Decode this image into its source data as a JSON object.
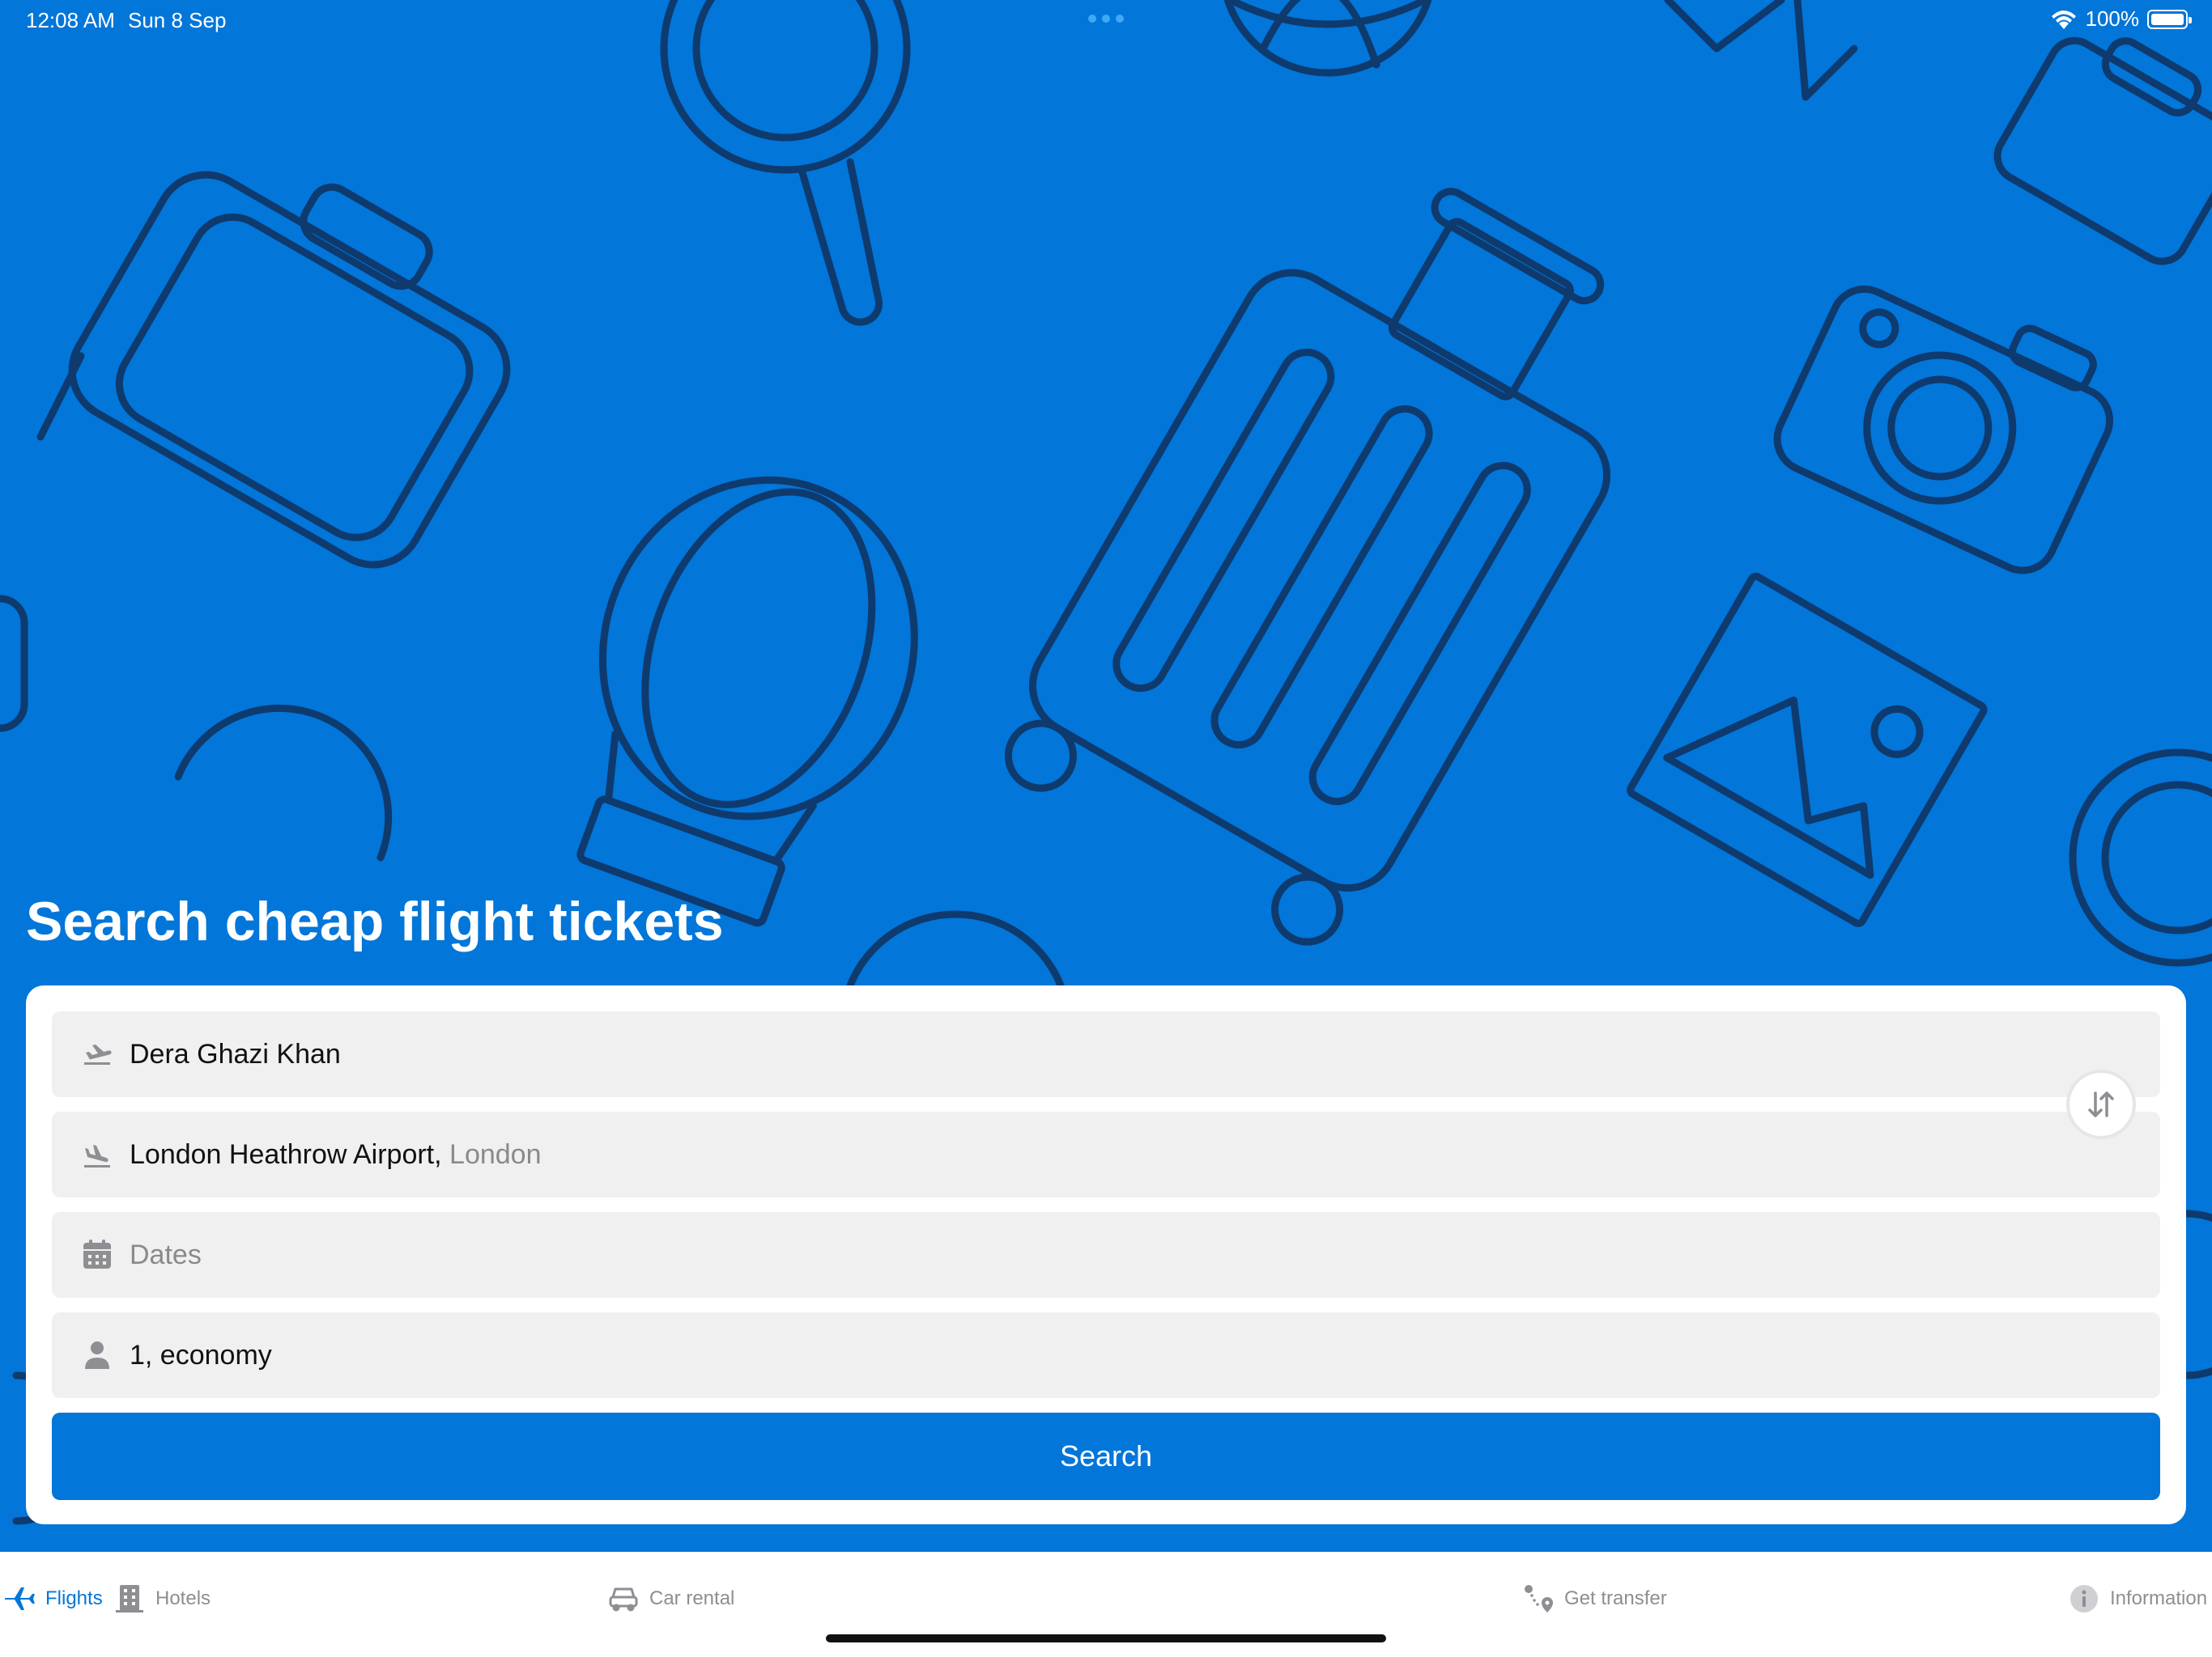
{
  "status_bar": {
    "time": "12:08 AM",
    "date": "Sun 8 Sep",
    "battery": "100%"
  },
  "headline": "Search cheap flight tickets",
  "form": {
    "origin": {
      "value": "Dera Ghazi Khan"
    },
    "destination": {
      "value": "London Heathrow Airport,",
      "hint": "London"
    },
    "dates": {
      "placeholder": "Dates"
    },
    "passengers": {
      "value": "1, economy"
    },
    "search_label": "Search"
  },
  "tabs": [
    {
      "label": "Flights",
      "icon": "airplane-icon",
      "active": true
    },
    {
      "label": "Hotels",
      "icon": "building-icon",
      "active": false
    },
    {
      "label": "Car rental",
      "icon": "car-icon",
      "active": false
    },
    {
      "label": "Get transfer",
      "icon": "route-pin-icon",
      "active": false
    },
    {
      "label": "Information",
      "icon": "info-icon",
      "active": false
    }
  ],
  "colors": {
    "brand": "#0276D9",
    "field_bg": "#F0F0F0",
    "inactive_tab": "#8E8E93"
  }
}
